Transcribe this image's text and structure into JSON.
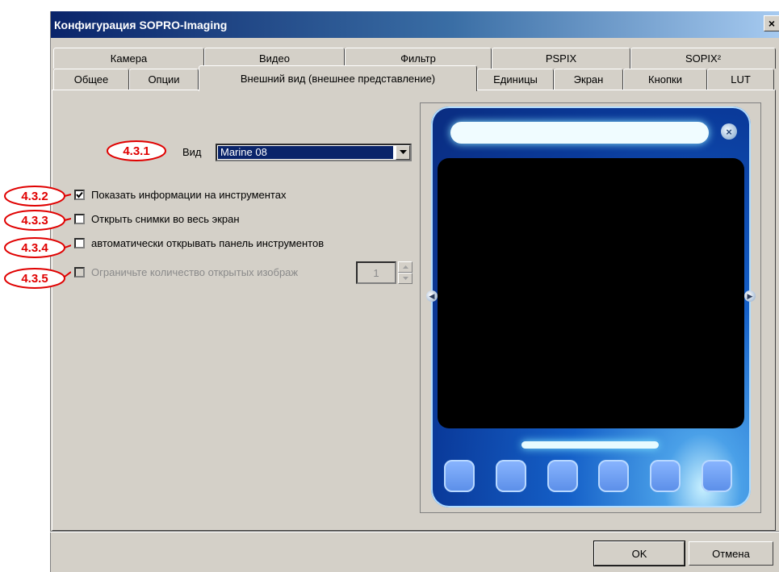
{
  "window": {
    "title": "Конфигурация SOPRO-Imaging",
    "close_glyph": "×"
  },
  "tabs": {
    "row1": [
      "Камера",
      "Видео",
      "Фильтр",
      "PSPIX",
      "SOPIX²"
    ],
    "row2": [
      "Общее",
      "Опции",
      "Внешний вид (внешнее представление)",
      "Единицы",
      "Экран",
      "Кнопки",
      "LUT"
    ],
    "active": "Внешний вид (внешнее представление)"
  },
  "appearance": {
    "vid_label": "Вид",
    "vid_value": "Marine 08",
    "options": [
      {
        "label": "Показать информации на инструментах",
        "checked": true,
        "enabled": true
      },
      {
        "label": "Открыть снимки во весь экран",
        "checked": false,
        "enabled": true
      },
      {
        "label": "автоматически открывать панель инструментов",
        "checked": false,
        "enabled": true
      },
      {
        "label": "Ограничьте количество открытых изображ",
        "checked": false,
        "enabled": false
      }
    ],
    "spin_value": "1"
  },
  "callouts": [
    "4.3.1",
    "4.3.2",
    "4.3.3",
    "4.3.4",
    "4.3.5"
  ],
  "buttons": {
    "ok": "OK",
    "cancel": "Отмена"
  },
  "colors": {
    "title_bar": "#0a246a",
    "callout": "#e00000",
    "face": "#d4d0c8",
    "skin_blue": "#1560c8"
  },
  "icons": {
    "checkmark": "check-icon",
    "dropdown": "chevron-down-icon",
    "close": "close-icon"
  }
}
